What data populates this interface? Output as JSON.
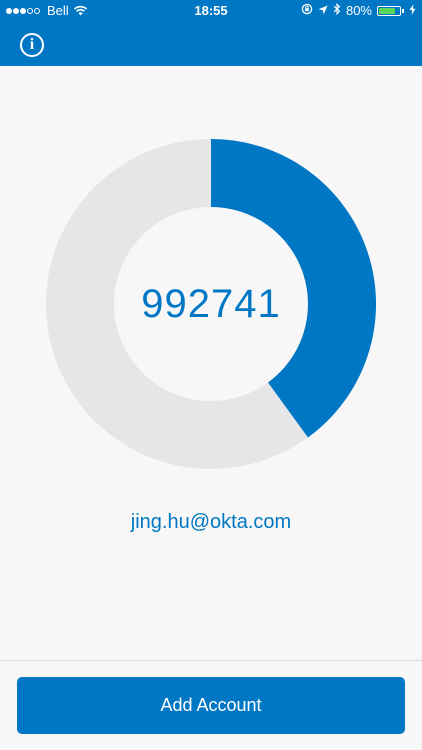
{
  "status_bar": {
    "carrier": "Bell",
    "time": "18:55",
    "battery_percent": "80%",
    "signal_bars_filled": 3,
    "signal_bars_total": 5,
    "battery_level": 0.8
  },
  "header": {
    "info_icon": "i",
    "color": "#0077c5"
  },
  "token": {
    "code": "992741",
    "remaining_fraction": 0.4,
    "ring_color": "#0077c5",
    "track_color": "#e6e6e8"
  },
  "account": {
    "email": "jing.hu@okta.com"
  },
  "footer": {
    "add_account_label": "Add Account"
  }
}
